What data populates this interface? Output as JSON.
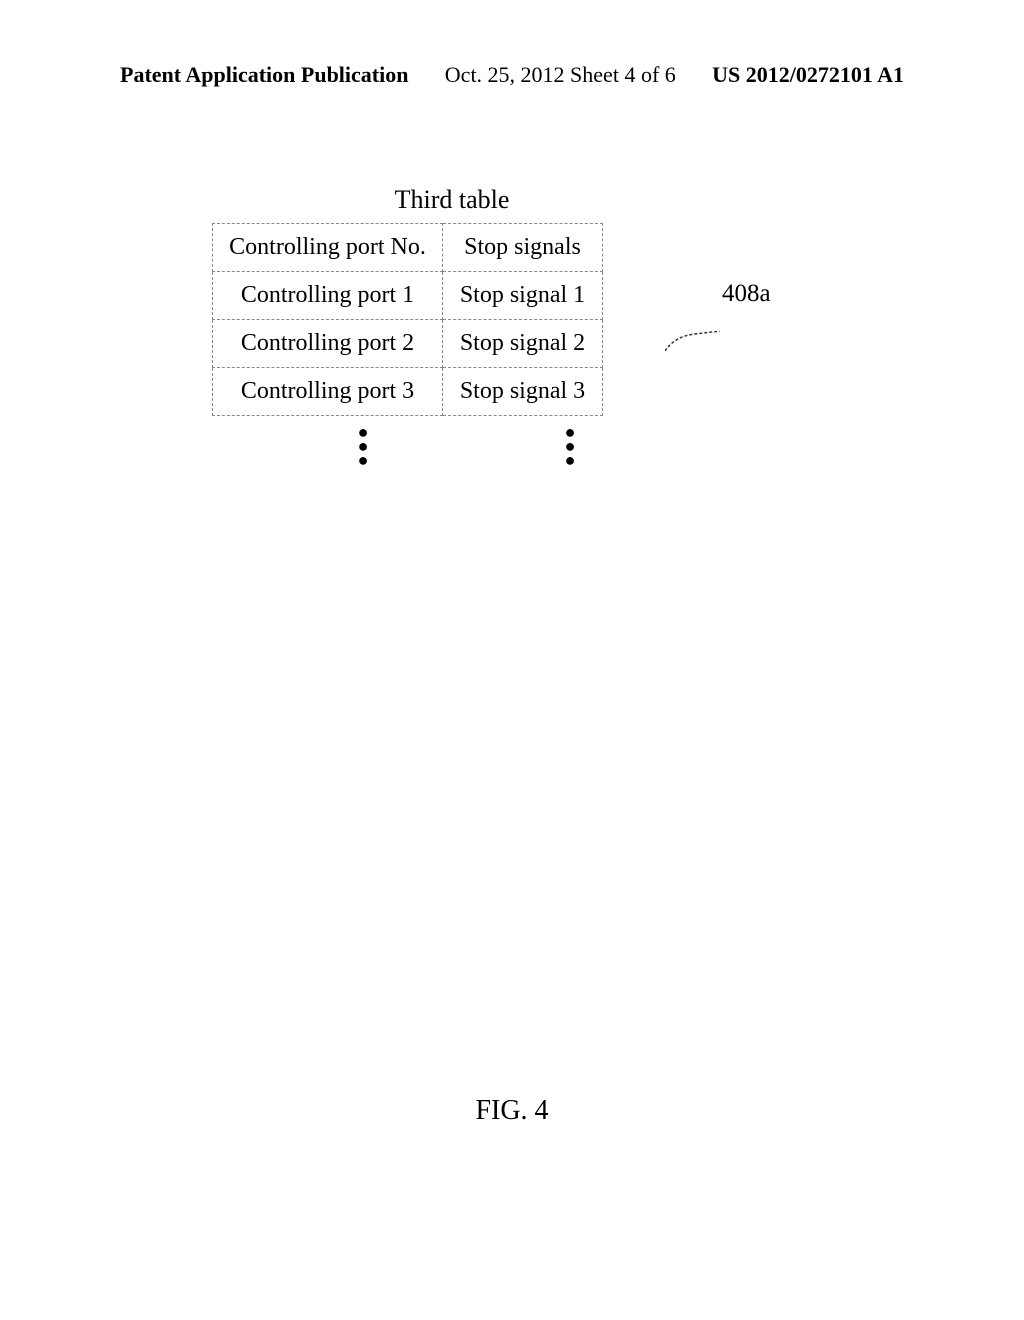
{
  "header": {
    "left": "Patent Application Publication",
    "center": "Oct. 25, 2012  Sheet 4 of 6",
    "right": "US 2012/0272101 A1"
  },
  "table": {
    "title": "Third table",
    "headers": [
      "Controlling port No.",
      "Stop signals"
    ],
    "rows": [
      [
        "Controlling port 1",
        "Stop signal 1"
      ],
      [
        "Controlling port 2",
        "Stop signal 2"
      ],
      [
        "Controlling port 3",
        "Stop signal 3"
      ]
    ]
  },
  "reference": "408a",
  "caption": "FIG. 4"
}
